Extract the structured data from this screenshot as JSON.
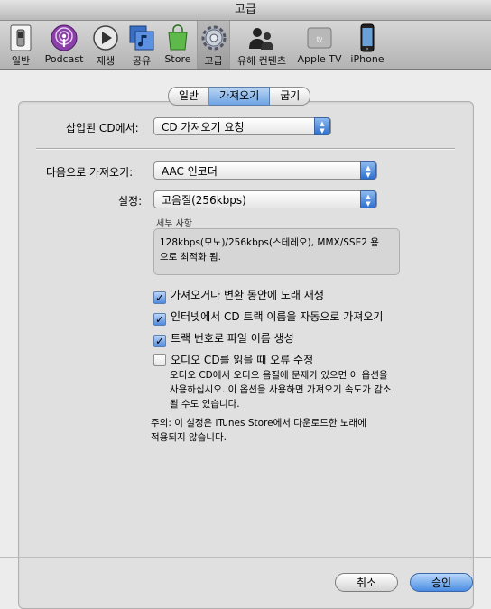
{
  "window": {
    "title": "고급"
  },
  "toolbar": {
    "items": [
      {
        "label": "일반",
        "icon": "general-switch-icon"
      },
      {
        "label": "Podcast",
        "icon": "podcast-icon"
      },
      {
        "label": "재생",
        "icon": "playback-icon"
      },
      {
        "label": "공유",
        "icon": "sharing-icon"
      },
      {
        "label": "Store",
        "icon": "store-icon"
      },
      {
        "label": "고급",
        "icon": "advanced-gear-icon"
      },
      {
        "label": "유해 컨텐츠",
        "icon": "parental-icon"
      },
      {
        "label": "Apple TV",
        "icon": "apple-tv-icon"
      },
      {
        "label": "iPhone",
        "icon": "iphone-icon"
      }
    ],
    "selected": "고급"
  },
  "tabs": {
    "items": [
      "일반",
      "가져오기",
      "굽기"
    ],
    "active": "가져오기"
  },
  "form": {
    "cd_insert_label": "삽입된 CD에서:",
    "cd_insert_value": "CD 가져오기 요청",
    "import_using_label": "다음으로 가져오기:",
    "import_using_value": "AAC 인코더",
    "setting_label": "설정:",
    "setting_value": "고음질(256kbps)",
    "details_title": "세부 사항",
    "details_text_1": "128kbps(모노)/256kbps(스테레오), MMX/SSE2 용",
    "details_text_2": "으로 최적화 됨."
  },
  "options": {
    "play_while_importing": {
      "label": "가져오거나 변환 동안에 노래 재생",
      "checked": true
    },
    "auto_cd_names": {
      "label": "인터넷에서 CD 트랙 이름을 자동으로 가져오기",
      "checked": true
    },
    "track_number_filenames": {
      "label": "트랙 번호로 파일 이름 생성",
      "checked": true
    },
    "error_correction": {
      "label": "오디오 CD를 읽을 때 오류 수정",
      "checked": false
    },
    "error_correction_desc_1": "오디오 CD에서 오디오 음질에 문제가 있으면 이 옵션을",
    "error_correction_desc_2": "사용하십시오. 이 옵션을 사용하면 가져오기 속도가 감소",
    "error_correction_desc_3": "될 수도 있습니다."
  },
  "note": {
    "line_1": "주의: 이 설정은 iTunes Store에서 다운로드한 노래에",
    "line_2": "적용되지 않습니다."
  },
  "buttons": {
    "cancel": "취소",
    "ok": "승인"
  },
  "colors": {
    "accent": "#4a8ce3"
  }
}
